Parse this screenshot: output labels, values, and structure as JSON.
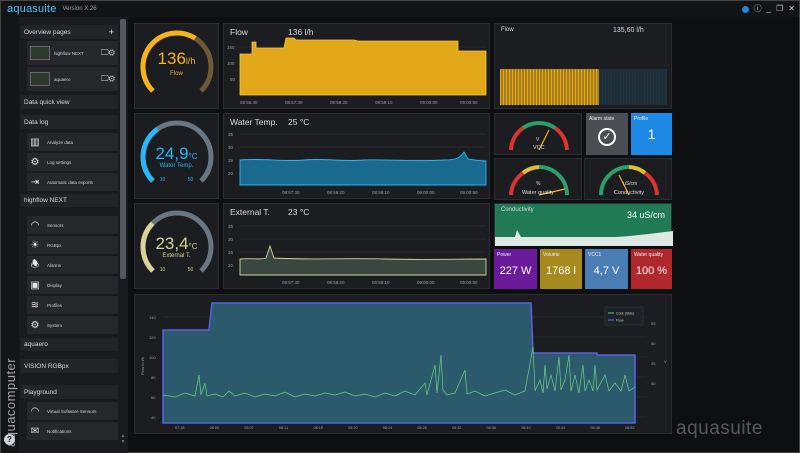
{
  "app": {
    "logo": "aquasuite",
    "version": "Version X.26",
    "brand_vertical": "aquacomputer",
    "brand_footer": "aquasuite",
    "help": "?"
  },
  "window": {
    "controls": [
      "ⓘ",
      "_",
      "❐",
      "✕"
    ]
  },
  "sidebar": {
    "overview": {
      "label": "Overview pages",
      "plus": "+"
    },
    "pages": [
      {
        "label": "highflow NEXT"
      },
      {
        "label": "aquaero"
      }
    ],
    "sections": {
      "data_quick_view": "Data quick view",
      "data_log": "Data log",
      "highflow_next": "highflow NEXT",
      "aquaero": "aquaero",
      "vision": "VISION RGBpx",
      "playground": "Playground"
    },
    "data_log_items": [
      {
        "label": "Analyze data",
        "icon": "bar-chart-icon"
      },
      {
        "label": "Log settings",
        "icon": "gear-icon"
      },
      {
        "label": "Automatic data exports",
        "icon": "export-icon"
      }
    ],
    "highflow_items": [
      {
        "label": "Sensors",
        "icon": "gauge-icon"
      },
      {
        "label": "RGBpx",
        "icon": "bulb-icon"
      },
      {
        "label": "Alarms",
        "icon": "alarm-icon"
      },
      {
        "label": "Display",
        "icon": "display-icon"
      },
      {
        "label": "Profiles",
        "icon": "layers-icon"
      },
      {
        "label": "System",
        "icon": "gear-icon"
      }
    ],
    "playground_items": [
      {
        "label": "Virtual Software Sensors",
        "icon": "gauge-icon"
      },
      {
        "label": "Notifications",
        "icon": "message-icon"
      }
    ]
  },
  "gauges": {
    "flow": {
      "value": "136",
      "unit": "l/h",
      "label": "Flow",
      "color": "#f5b41e",
      "fraction": 0.62
    },
    "water": {
      "value": "24,9",
      "unit": "°C",
      "label": "Water Temp.",
      "min": "10",
      "max": "50",
      "color": "#29b6f6",
      "fraction": 0.37
    },
    "external": {
      "value": "23,4",
      "unit": "°C",
      "label": "External T.",
      "min": "10",
      "max": "50",
      "color": "#d7d39a",
      "fraction": 0.33
    }
  },
  "charts": {
    "flow": {
      "title": "Flow",
      "value": "136 l/h",
      "color": "#f5b41e",
      "yticks": [
        "150",
        "100",
        "50"
      ],
      "xticks": [
        "08:56:40",
        "08:57:30",
        "08:58:20",
        "08:59:10",
        "09:00:00",
        "09:00:50"
      ]
    },
    "water": {
      "title": "Water Temp.",
      "value": "25 °C",
      "color": "#29b6f6",
      "yticks": [
        "35",
        "30",
        "25",
        "20"
      ],
      "xticks": [
        "08:57:30",
        "08:58:20",
        "08:59:10",
        "09:00:00",
        "09:00:50"
      ]
    },
    "external": {
      "title": "External T.",
      "value": "23 °C",
      "color": "#d7d39a",
      "yticks": [
        "35",
        "30",
        "25",
        "20"
      ],
      "xticks": [
        "08:57:30",
        "08:58:20",
        "08:59:10",
        "09:00:00",
        "09:00:50"
      ]
    },
    "flow_bars": {
      "title": "Flow",
      "value": "135,60 l/h",
      "color": "#f5b41e"
    },
    "conductivity": {
      "title": "Conductivity",
      "value": "34 uS/cm"
    },
    "big": {
      "ylabel_left": "Flow in l/h",
      "ylabel_right": "V",
      "yticks_left": [
        "140",
        "120",
        "100",
        "80",
        "60",
        "40"
      ],
      "yticks_right": [
        "55",
        "50",
        "45",
        "40"
      ],
      "xticks": [
        "07:18",
        "08:00",
        "08:07",
        "08:11",
        "08:15",
        "08:20",
        "08:24",
        "08:28",
        "08:32",
        "08:36",
        "08:40",
        "08:44",
        "08:48",
        "08:52"
      ],
      "legend": [
        {
          "name": "Core (Sidu)",
          "color": "#4caf7d"
        },
        {
          "name": "Flow",
          "color": "#5a5fe0"
        }
      ]
    }
  },
  "meters": {
    "vcc": {
      "label": "VCC",
      "unit": "V"
    },
    "water_quality": {
      "label": "Water quality",
      "unit": "%"
    },
    "conductivity": {
      "label": "Conductivity",
      "unit": "uS/cm"
    }
  },
  "tiles": {
    "alarm": {
      "title": "Alarm state",
      "color": "#4a4d52"
    },
    "profile": {
      "title": "Profile",
      "value": "1",
      "color": "#1e88e5"
    },
    "power": {
      "title": "Power",
      "value": "227 W",
      "color": "#6a1b9a"
    },
    "volume": {
      "title": "Volume",
      "value": "1768 l",
      "color": "#a68a1e"
    },
    "vcc": {
      "title": "VCC1",
      "value": "4,7 V",
      "color": "#4a7db3"
    },
    "water_quality": {
      "title": "Water quality",
      "value": "100 %",
      "color": "#b0282d"
    }
  }
}
